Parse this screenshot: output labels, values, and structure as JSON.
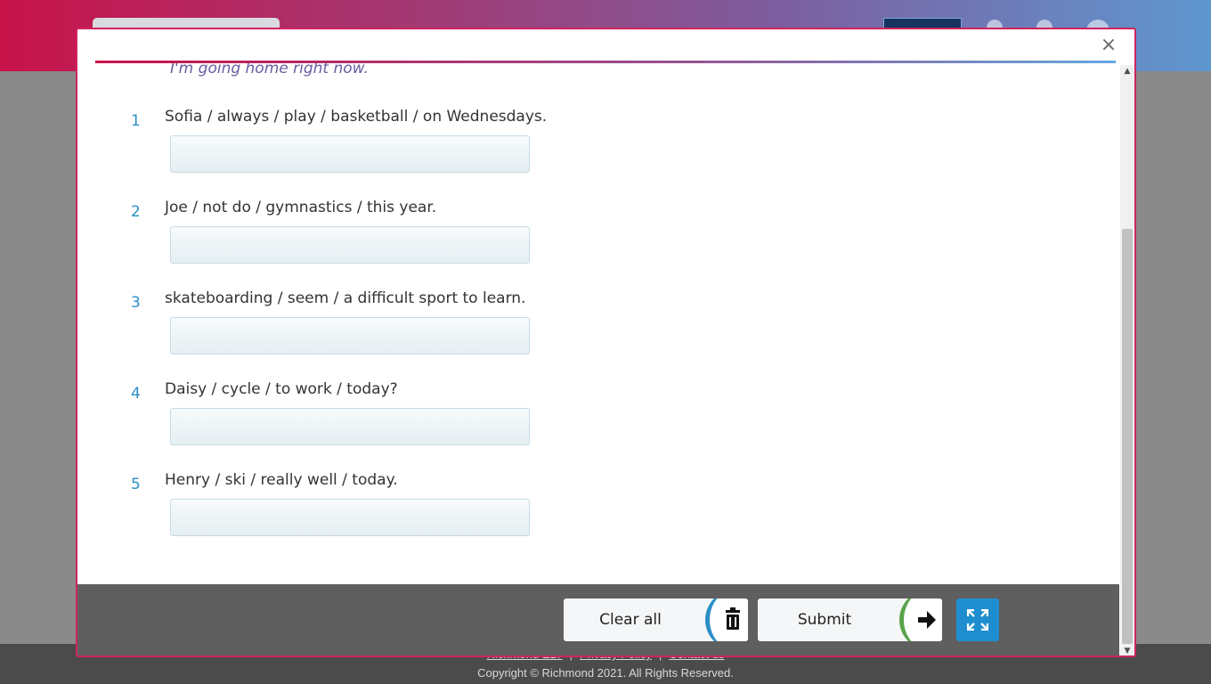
{
  "example": {
    "text": "I'm going home right now."
  },
  "questions": [
    {
      "number": "1",
      "prompt": "Sofia / always / play / basketball / on Wednesdays.",
      "answer": ""
    },
    {
      "number": "2",
      "prompt": "Joe / not do / gymnastics / this year.",
      "answer": ""
    },
    {
      "number": "3",
      "prompt": "skateboarding / seem / a difficult sport to learn.",
      "answer": ""
    },
    {
      "number": "4",
      "prompt": "Daisy / cycle / to work / today?",
      "answer": ""
    },
    {
      "number": "5",
      "prompt": "Henry / ski / really well / today.",
      "answer": ""
    }
  ],
  "actions": {
    "clear_label": "Clear all",
    "clear_icon": "trash-icon",
    "submit_label": "Submit",
    "submit_icon": "arrow-right-icon",
    "expand_icon": "expand-icon"
  },
  "modal": {
    "close_icon": "close-icon",
    "close_glyph": "×"
  },
  "footer": {
    "links": [
      "Richmond ELT",
      "Privacy Policy",
      "Contact us"
    ],
    "copyright": "Copyright © Richmond 2021. All Rights Reserved."
  },
  "colors": {
    "modal_border": "#d0245e",
    "number_accent": "#2a8fc7",
    "clear_accent": "#2a8fc7",
    "submit_accent": "#5aa34a",
    "expand_bg": "#1f8ed0",
    "action_bar": "#5f5f5f"
  }
}
